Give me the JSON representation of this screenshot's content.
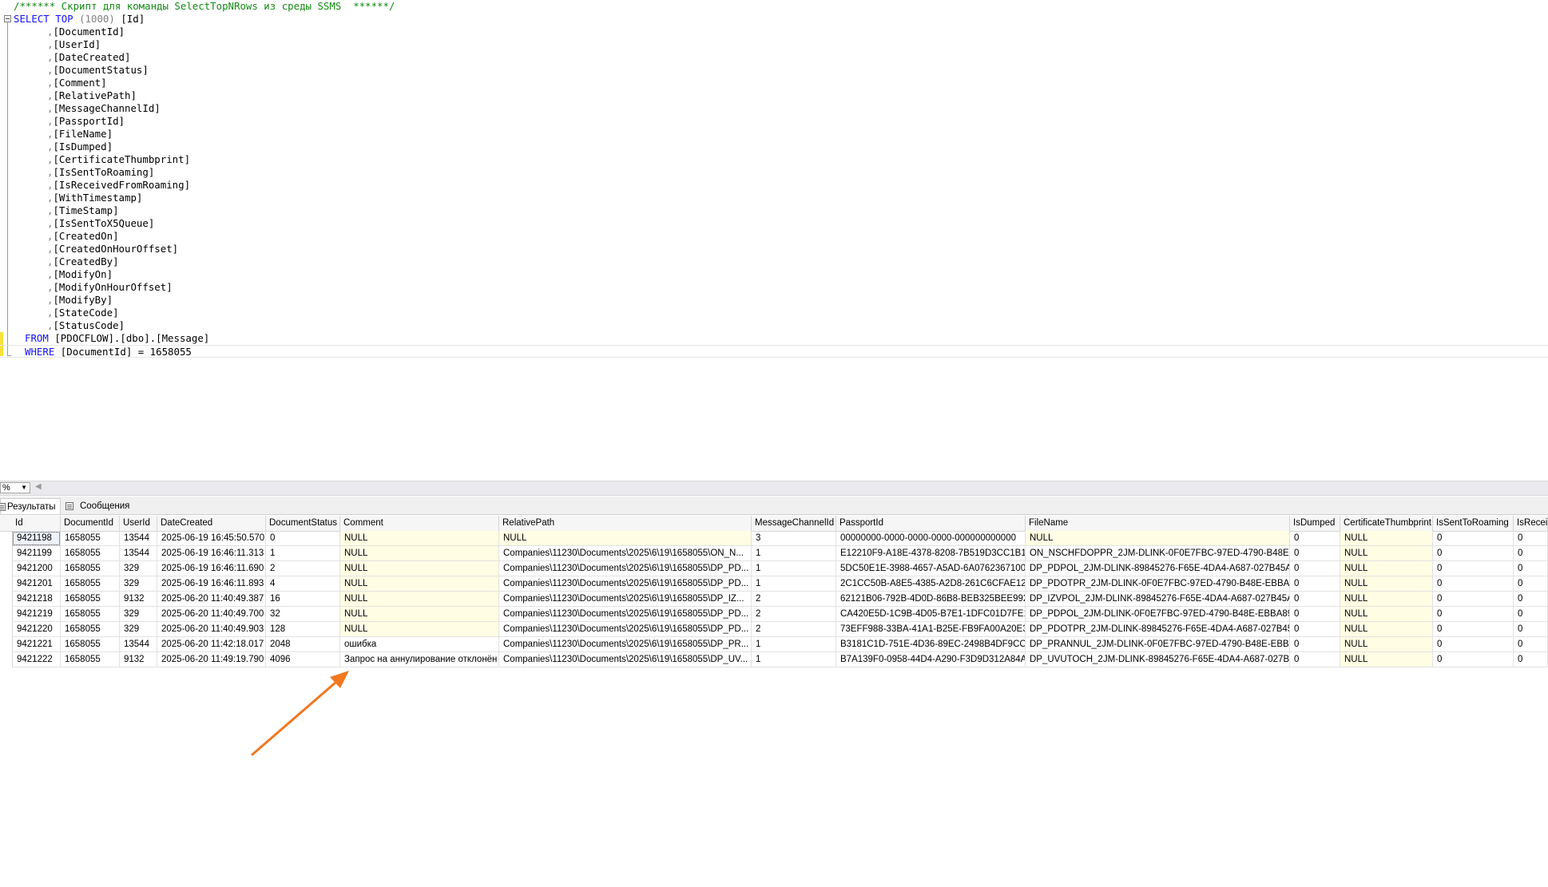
{
  "editor": {
    "comment_line": "/****** Скрипт для команды SelectTopNRows из среды SSMS  ******/",
    "select_kw": "SELECT",
    "top_kw": "TOP",
    "top_value": "(1000)",
    "first_column": "[Id]",
    "columns": [
      "[DocumentId]",
      "[UserId]",
      "[DateCreated]",
      "[DocumentStatus]",
      "[Comment]",
      "[RelativePath]",
      "[MessageChannelId]",
      "[PassportId]",
      "[FileName]",
      "[IsDumped]",
      "[CertificateThumbprint]",
      "[IsSentToRoaming]",
      "[IsReceivedFromRoaming]",
      "[WithTimestamp]",
      "[TimeStamp]",
      "[IsSentToX5Queue]",
      "[CreatedOn]",
      "[CreatedOnHourOffset]",
      "[CreatedBy]",
      "[ModifyOn]",
      "[ModifyOnHourOffset]",
      "[ModifyBy]",
      "[StateCode]",
      "[StatusCode]"
    ],
    "from_kw": "FROM",
    "from_table": "[PDOCFLOW].[dbo].[Message]",
    "where_kw": "WHERE",
    "where_clause": "[DocumentId] = 1658055"
  },
  "zoom": {
    "value": "%"
  },
  "tabs": {
    "results": "Результаты",
    "messages": "Сообщения"
  },
  "grid": {
    "columns": [
      "Id",
      "DocumentId",
      "UserId",
      "DateCreated",
      "DocumentStatus",
      "Comment",
      "RelativePath",
      "MessageChannelId",
      "PassportId",
      "FileName",
      "IsDumped",
      "CertificateThumbprint",
      "IsSentToRoaming",
      "IsRecei"
    ],
    "rows": [
      [
        "9421198",
        "1658055",
        "13544",
        "2025-06-19 16:45:50.570",
        "0",
        "NULL",
        "NULL",
        "3",
        "00000000-0000-0000-0000-000000000000",
        "NULL",
        "0",
        "NULL",
        "0",
        "0"
      ],
      [
        "9421199",
        "1658055",
        "13544",
        "2025-06-19 16:46:11.313",
        "1",
        "NULL",
        "Companies\\11230\\Documents\\2025\\6\\19\\1658055\\ON_N...",
        "1",
        "E12210F9-A18E-4378-8208-7B519D3CC1B1",
        "ON_NSCHFDOPPR_2JM-DLINK-0F0E7FBC-97ED-4790-B48E-...",
        "0",
        "NULL",
        "0",
        "0"
      ],
      [
        "9421200",
        "1658055",
        "329",
        "2025-06-19 16:46:11.690",
        "2",
        "NULL",
        "Companies\\11230\\Documents\\2025\\6\\19\\1658055\\DP_PD...",
        "1",
        "5DC50E1E-3988-4657-A5AD-6A0762367100",
        "DP_PDPOL_2JM-DLINK-89845276-F65E-4DA4-A687-027B45A...",
        "0",
        "NULL",
        "0",
        "0"
      ],
      [
        "9421201",
        "1658055",
        "329",
        "2025-06-19 16:46:11.893",
        "4",
        "NULL",
        "Companies\\11230\\Documents\\2025\\6\\19\\1658055\\DP_PD...",
        "1",
        "2C1CC50B-A8E5-4385-A2D8-261C6CFAE126",
        "DP_PDOTPR_2JM-DLINK-0F0E7FBC-97ED-4790-B48E-EBBA8...",
        "0",
        "NULL",
        "0",
        "0"
      ],
      [
        "9421218",
        "1658055",
        "9132",
        "2025-06-20 11:40:49.387",
        "16",
        "NULL",
        "Companies\\11230\\Documents\\2025\\6\\19\\1658055\\DP_IZ...",
        "2",
        "62121B06-792B-4D0D-86B8-BEB325BEE992",
        "DP_IZVPOL_2JM-DLINK-89845276-F65E-4DA4-A687-027B45A...",
        "0",
        "NULL",
        "0",
        "0"
      ],
      [
        "9421219",
        "1658055",
        "329",
        "2025-06-20 11:40:49.700",
        "32",
        "NULL",
        "Companies\\11230\\Documents\\2025\\6\\19\\1658055\\DP_PD...",
        "2",
        "CA420E5D-1C9B-4D05-B7E1-1DFC01D7FE16",
        "DP_PDPOL_2JM-DLINK-0F0E7FBC-97ED-4790-B48E-EBBA89...",
        "0",
        "NULL",
        "0",
        "0"
      ],
      [
        "9421220",
        "1658055",
        "329",
        "2025-06-20 11:40:49.903",
        "128",
        "NULL",
        "Companies\\11230\\Documents\\2025\\6\\19\\1658055\\DP_PD...",
        "2",
        "73EFF988-33BA-41A1-B25E-FB9FA00A20E3",
        "DP_PDOTPR_2JM-DLINK-89845276-F65E-4DA4-A687-027B45...",
        "0",
        "NULL",
        "0",
        "0"
      ],
      [
        "9421221",
        "1658055",
        "13544",
        "2025-06-20 11:42:18.017",
        "2048",
        "ошибка",
        "Companies\\11230\\Documents\\2025\\6\\19\\1658055\\DP_PR...",
        "1",
        "B3181C1D-751E-4D36-89EC-2498B4DF9CC1",
        "DP_PRANNUL_2JM-DLINK-0F0E7FBC-97ED-4790-B48E-EBBA...",
        "0",
        "NULL",
        "0",
        "0"
      ],
      [
        "9421222",
        "1658055",
        "9132",
        "2025-06-20 11:49:19.790",
        "4096",
        "Запрос на аннулирование отклонён",
        "Companies\\11230\\Documents\\2025\\6\\19\\1658055\\DP_UV...",
        "1",
        "B7A139F0-0958-44D4-A290-F3D9D312A84A",
        "DP_UVUTOCH_2JM-DLINK-89845276-F65E-4DA4-A687-027B4...",
        "0",
        "NULL",
        "0",
        "0"
      ]
    ]
  },
  "colors": {
    "keyword": "#1111ff",
    "comment": "#138a13",
    "null_cell": "#fffde3",
    "arrow": "#f07820"
  }
}
